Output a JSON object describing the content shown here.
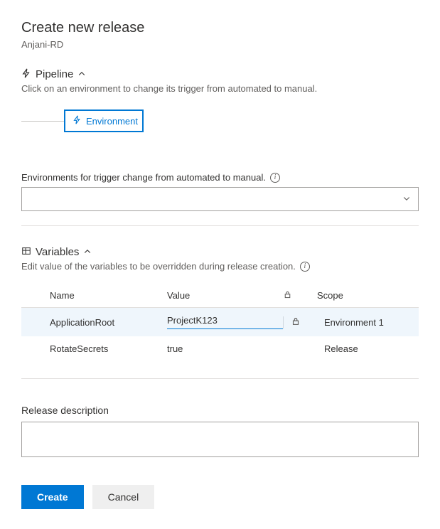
{
  "header": {
    "title": "Create new release",
    "subtitle": "Anjani-RD"
  },
  "pipeline": {
    "section_label": "Pipeline",
    "desc": "Click on an environment to change its trigger from automated to manual.",
    "stage_label": "Environment"
  },
  "env_trigger": {
    "label": "Environments for trigger change from automated to manual."
  },
  "variables": {
    "section_label": "Variables",
    "desc": "Edit value of the variables to be overridden during release creation.",
    "columns": {
      "name": "Name",
      "value": "Value",
      "scope": "Scope"
    },
    "rows": [
      {
        "name": "ApplicationRoot",
        "value": "ProjectK123",
        "locked": true,
        "scope": "Environment 1",
        "active": true
      },
      {
        "name": "RotateSecrets",
        "value": "true",
        "locked": false,
        "scope": "Release",
        "active": false
      }
    ]
  },
  "release_desc": {
    "label": "Release description",
    "value": ""
  },
  "buttons": {
    "create": "Create",
    "cancel": "Cancel"
  }
}
